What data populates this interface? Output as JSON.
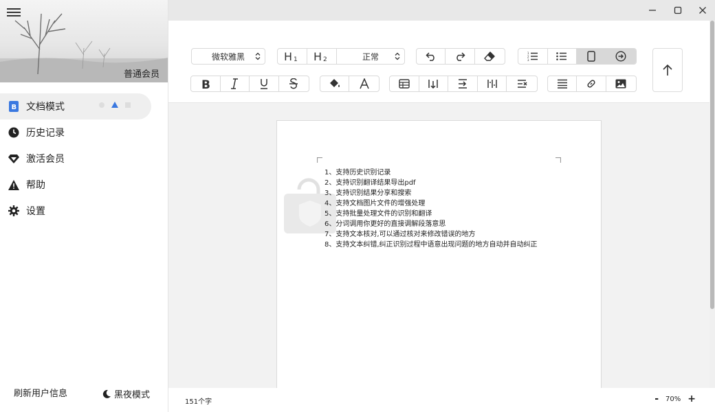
{
  "sidebar": {
    "member_label": "普通会员",
    "items": [
      {
        "label": "文档模式",
        "icon": "doc-mode-icon"
      },
      {
        "label": "历史记录",
        "icon": "clock-icon"
      },
      {
        "label": "激活会员",
        "icon": "diamond-icon"
      },
      {
        "label": "帮助",
        "icon": "warning-icon"
      },
      {
        "label": "设置",
        "icon": "gear-icon"
      }
    ],
    "refresh_label": "刷新用户信息",
    "dark_mode_label": "黑夜模式"
  },
  "toolbar": {
    "font_value": "微软雅黑",
    "h1": "H1",
    "h2": "H2",
    "paragraph_value": "正常"
  },
  "document": {
    "lines": [
      "1、支持历史识别记录",
      "2、支持识别翻译结果导出pdf",
      "3、支持识别结果分享和搜索",
      "4、支持文档图片文件的增强处理",
      "5、支持批量处理文件的识别和翻译",
      "6、分词调用你更好的直接调解段落意思",
      "7、支持文本核对,可以通过核对来修改错误的地方",
      "8、支持文本纠错,纠正识别过程中语意出现问题的地方自动并自动纠正"
    ]
  },
  "status": {
    "char_count": "151个字",
    "zoom": "70%",
    "zoom_minus": "-",
    "zoom_plus": "+"
  },
  "colors": {
    "accent": "#3a78e0",
    "active_bg": "#efefef"
  }
}
